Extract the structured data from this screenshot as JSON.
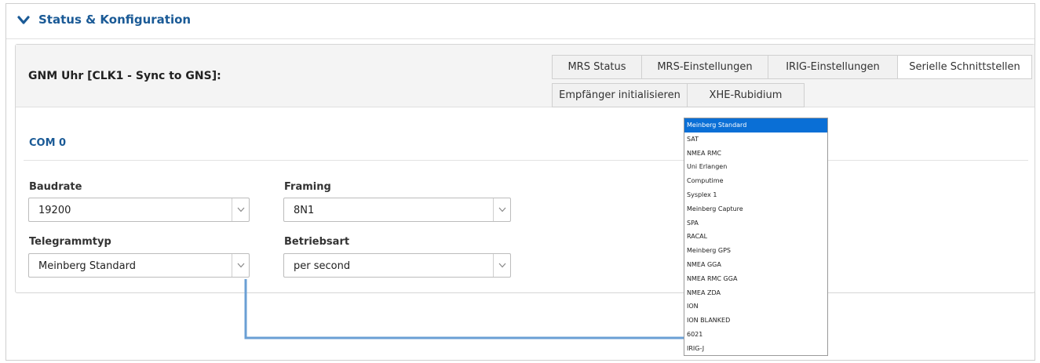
{
  "section": {
    "title": "Status & Konfiguration"
  },
  "clock": {
    "title": "GNM Uhr [CLK1 - Sync to GNS]:"
  },
  "tabs_row1": [
    "MRS Status",
    "MRS-Einstellungen",
    "IRIG-Einstellungen",
    "Serielle Schnittstellen"
  ],
  "tabs_row2": [
    "Empfänger initialisieren",
    "XHE-Rubidium"
  ],
  "active_tab": "Serielle Schnittstellen",
  "com": {
    "title": "COM 0"
  },
  "fields": {
    "baudrate": {
      "label": "Baudrate",
      "value": "19200"
    },
    "framing": {
      "label": "Framing",
      "value": "8N1"
    },
    "telegrammtyp": {
      "label": "Telegrammtyp",
      "value": "Meinberg Standard"
    },
    "betriebsart": {
      "label": "Betriebsart",
      "value": "per second"
    }
  },
  "dropdown": {
    "options": [
      "Meinberg Standard",
      "SAT",
      "NMEA RMC",
      "Uni Erlangen",
      "Computime",
      "Sysplex 1",
      "Meinberg Capture",
      "SPA",
      "RACAL",
      "Meinberg GPS",
      "NMEA GGA",
      "NMEA RMC GGA",
      "NMEA ZDA",
      "ION",
      "ION BLANKED",
      "6021",
      "IRIG-J"
    ],
    "selected_index": 0
  },
  "colors": {
    "accent": "#1a5a96",
    "selection": "#0a6fd6",
    "connector": "#6a9fd4"
  },
  "icons": {
    "section_toggle": "chevron-down-icon",
    "select_arrow": "chevron-down-icon"
  }
}
